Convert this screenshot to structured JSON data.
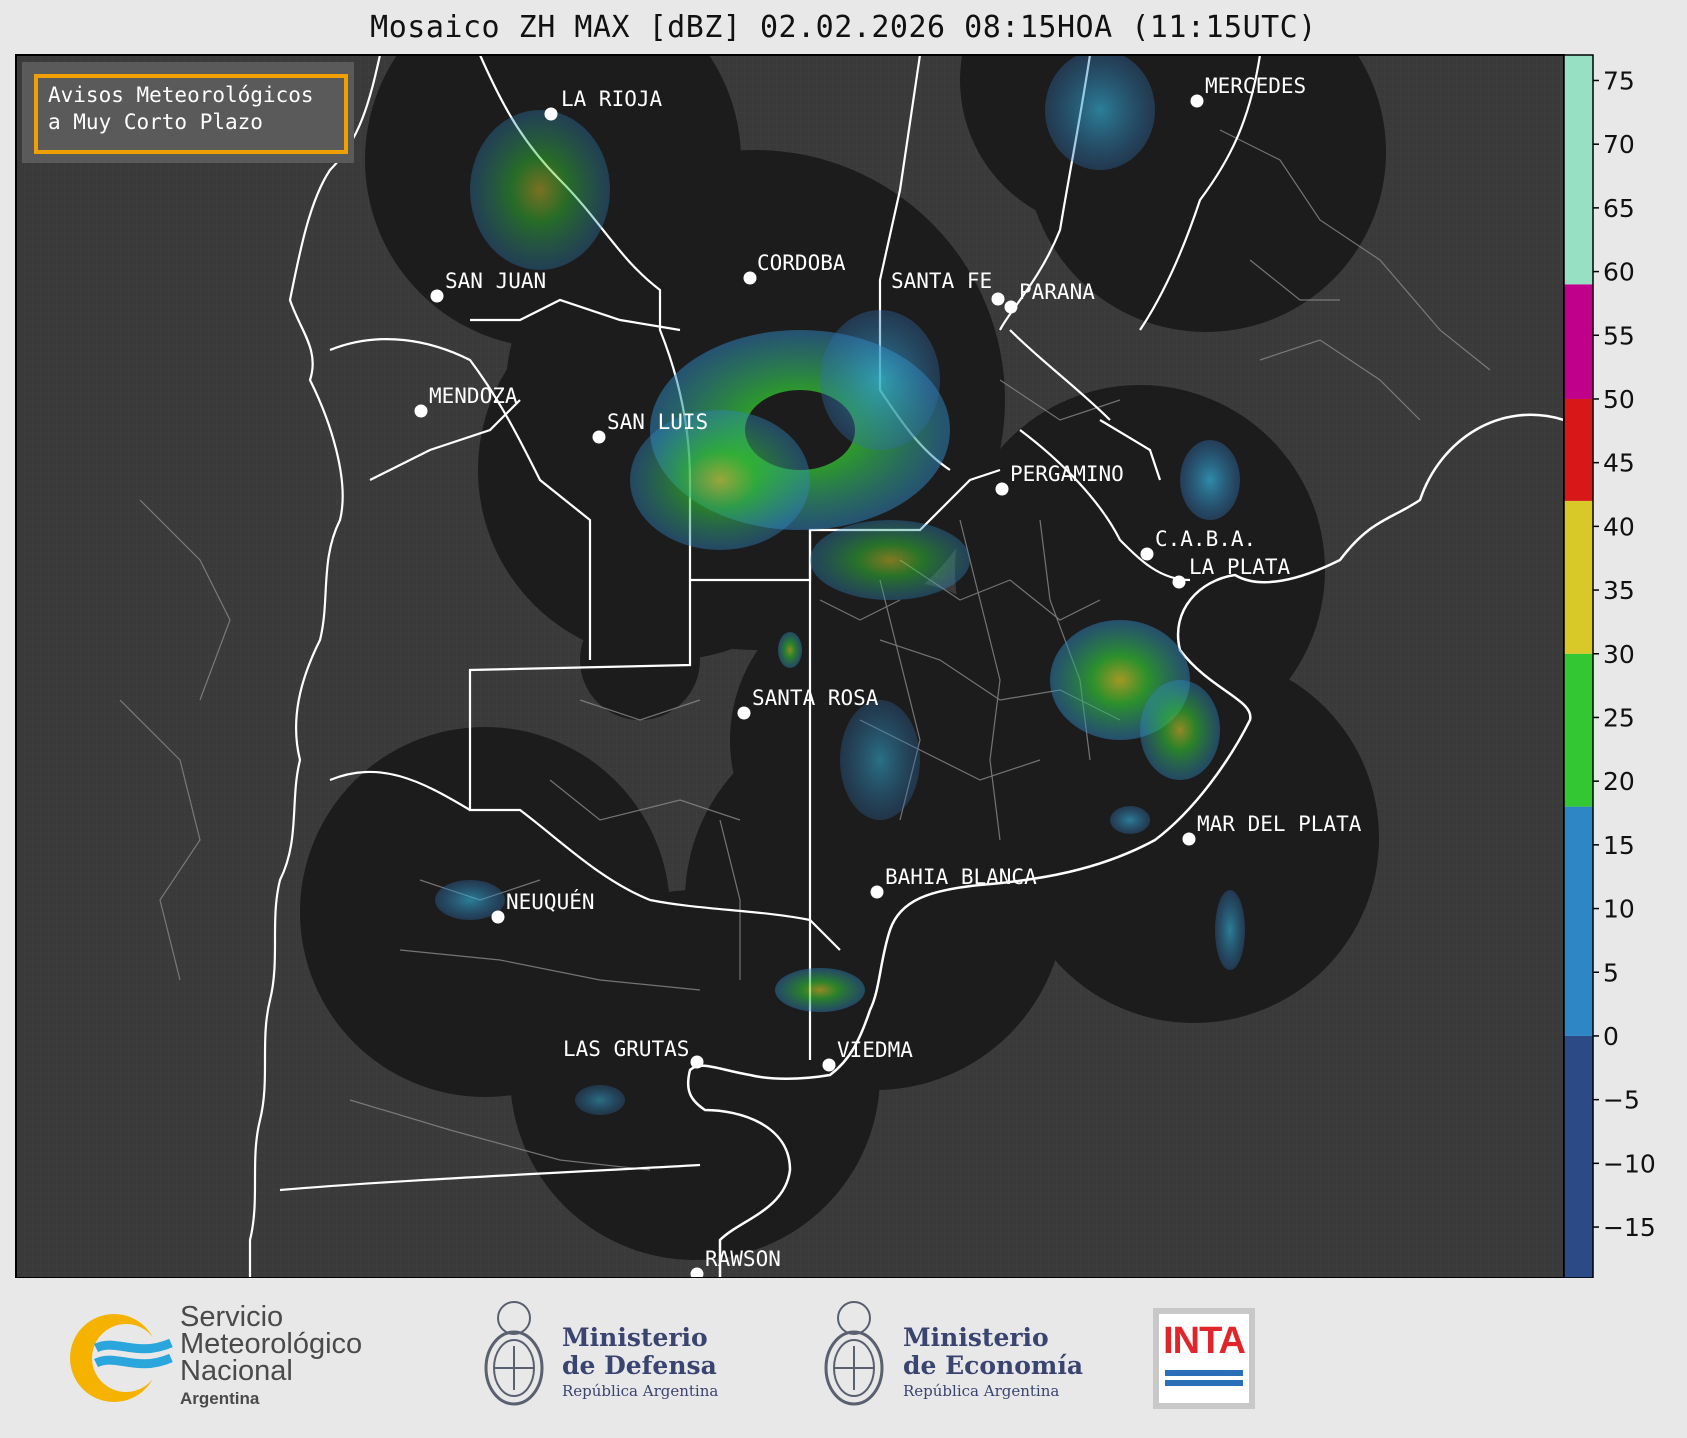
{
  "title": "Mosaico ZH MAX [dBZ] 02.02.2026 08:15HOA (11:15UTC)",
  "alert_box": {
    "line1": "Avisos Meteorológicos",
    "line2": "a Muy Corto Plazo",
    "border_color": "#f0a000"
  },
  "cities": [
    {
      "name": "LA RIOJA"
    },
    {
      "name": "MERCEDES"
    },
    {
      "name": "CORDOBA"
    },
    {
      "name": "SAN JUAN"
    },
    {
      "name": "SANTA FE"
    },
    {
      "name": "PARANA"
    },
    {
      "name": "MENDOZA"
    },
    {
      "name": "SAN LUIS"
    },
    {
      "name": "PERGAMINO"
    },
    {
      "name": "C.A.B.A."
    },
    {
      "name": "LA PLATA"
    },
    {
      "name": "SANTA ROSA"
    },
    {
      "name": "MAR DEL PLATA"
    },
    {
      "name": "BAHIA BLANCA"
    },
    {
      "name": "NEUQUÉN"
    },
    {
      "name": "LAS GRUTAS"
    },
    {
      "name": "VIEDMA"
    },
    {
      "name": "RAWSON"
    }
  ],
  "colorbar": {
    "unit": "dBZ",
    "ticks": [
      "75",
      "70",
      "65",
      "60",
      "55",
      "50",
      "45",
      "40",
      "35",
      "30",
      "25",
      "20",
      "15",
      "10",
      "5",
      "0",
      "−5",
      "−10",
      "−15"
    ],
    "scale": [
      {
        "from": -19,
        "to": 0,
        "color": "#2b4a86"
      },
      {
        "from": 0,
        "to": 18,
        "color": "#2f86c4"
      },
      {
        "from": 18,
        "to": 30,
        "color": "#33c733"
      },
      {
        "from": 30,
        "to": 42,
        "color": "#d8c828"
      },
      {
        "from": 42,
        "to": 50,
        "color": "#d81818"
      },
      {
        "from": 50,
        "to": 59,
        "color": "#c0008a"
      },
      {
        "from": 59,
        "to": 77,
        "color": "#98e0c4"
      }
    ]
  },
  "colors": {
    "background": "#3a3a3a",
    "radar_coverage": "#1c1c1c",
    "province_border": "#ffffff",
    "department_border": "#8a8a8a"
  },
  "footer": {
    "smn": {
      "line1": "Servicio",
      "line2": "Meteorológico",
      "line3": "Nacional",
      "line4": "Argentina",
      "icon": "smn-logo-icon"
    },
    "defensa": {
      "line1": "Ministerio",
      "line2": "de Defensa",
      "line3": "República Argentina",
      "icon": "argentina-coat-of-arms-icon"
    },
    "economia": {
      "line1": "Ministerio",
      "line2": "de Economía",
      "line3": "República Argentina",
      "icon": "argentina-coat-of-arms-icon"
    },
    "inta": {
      "label": "INTA",
      "icon": "inta-logo-icon"
    }
  }
}
